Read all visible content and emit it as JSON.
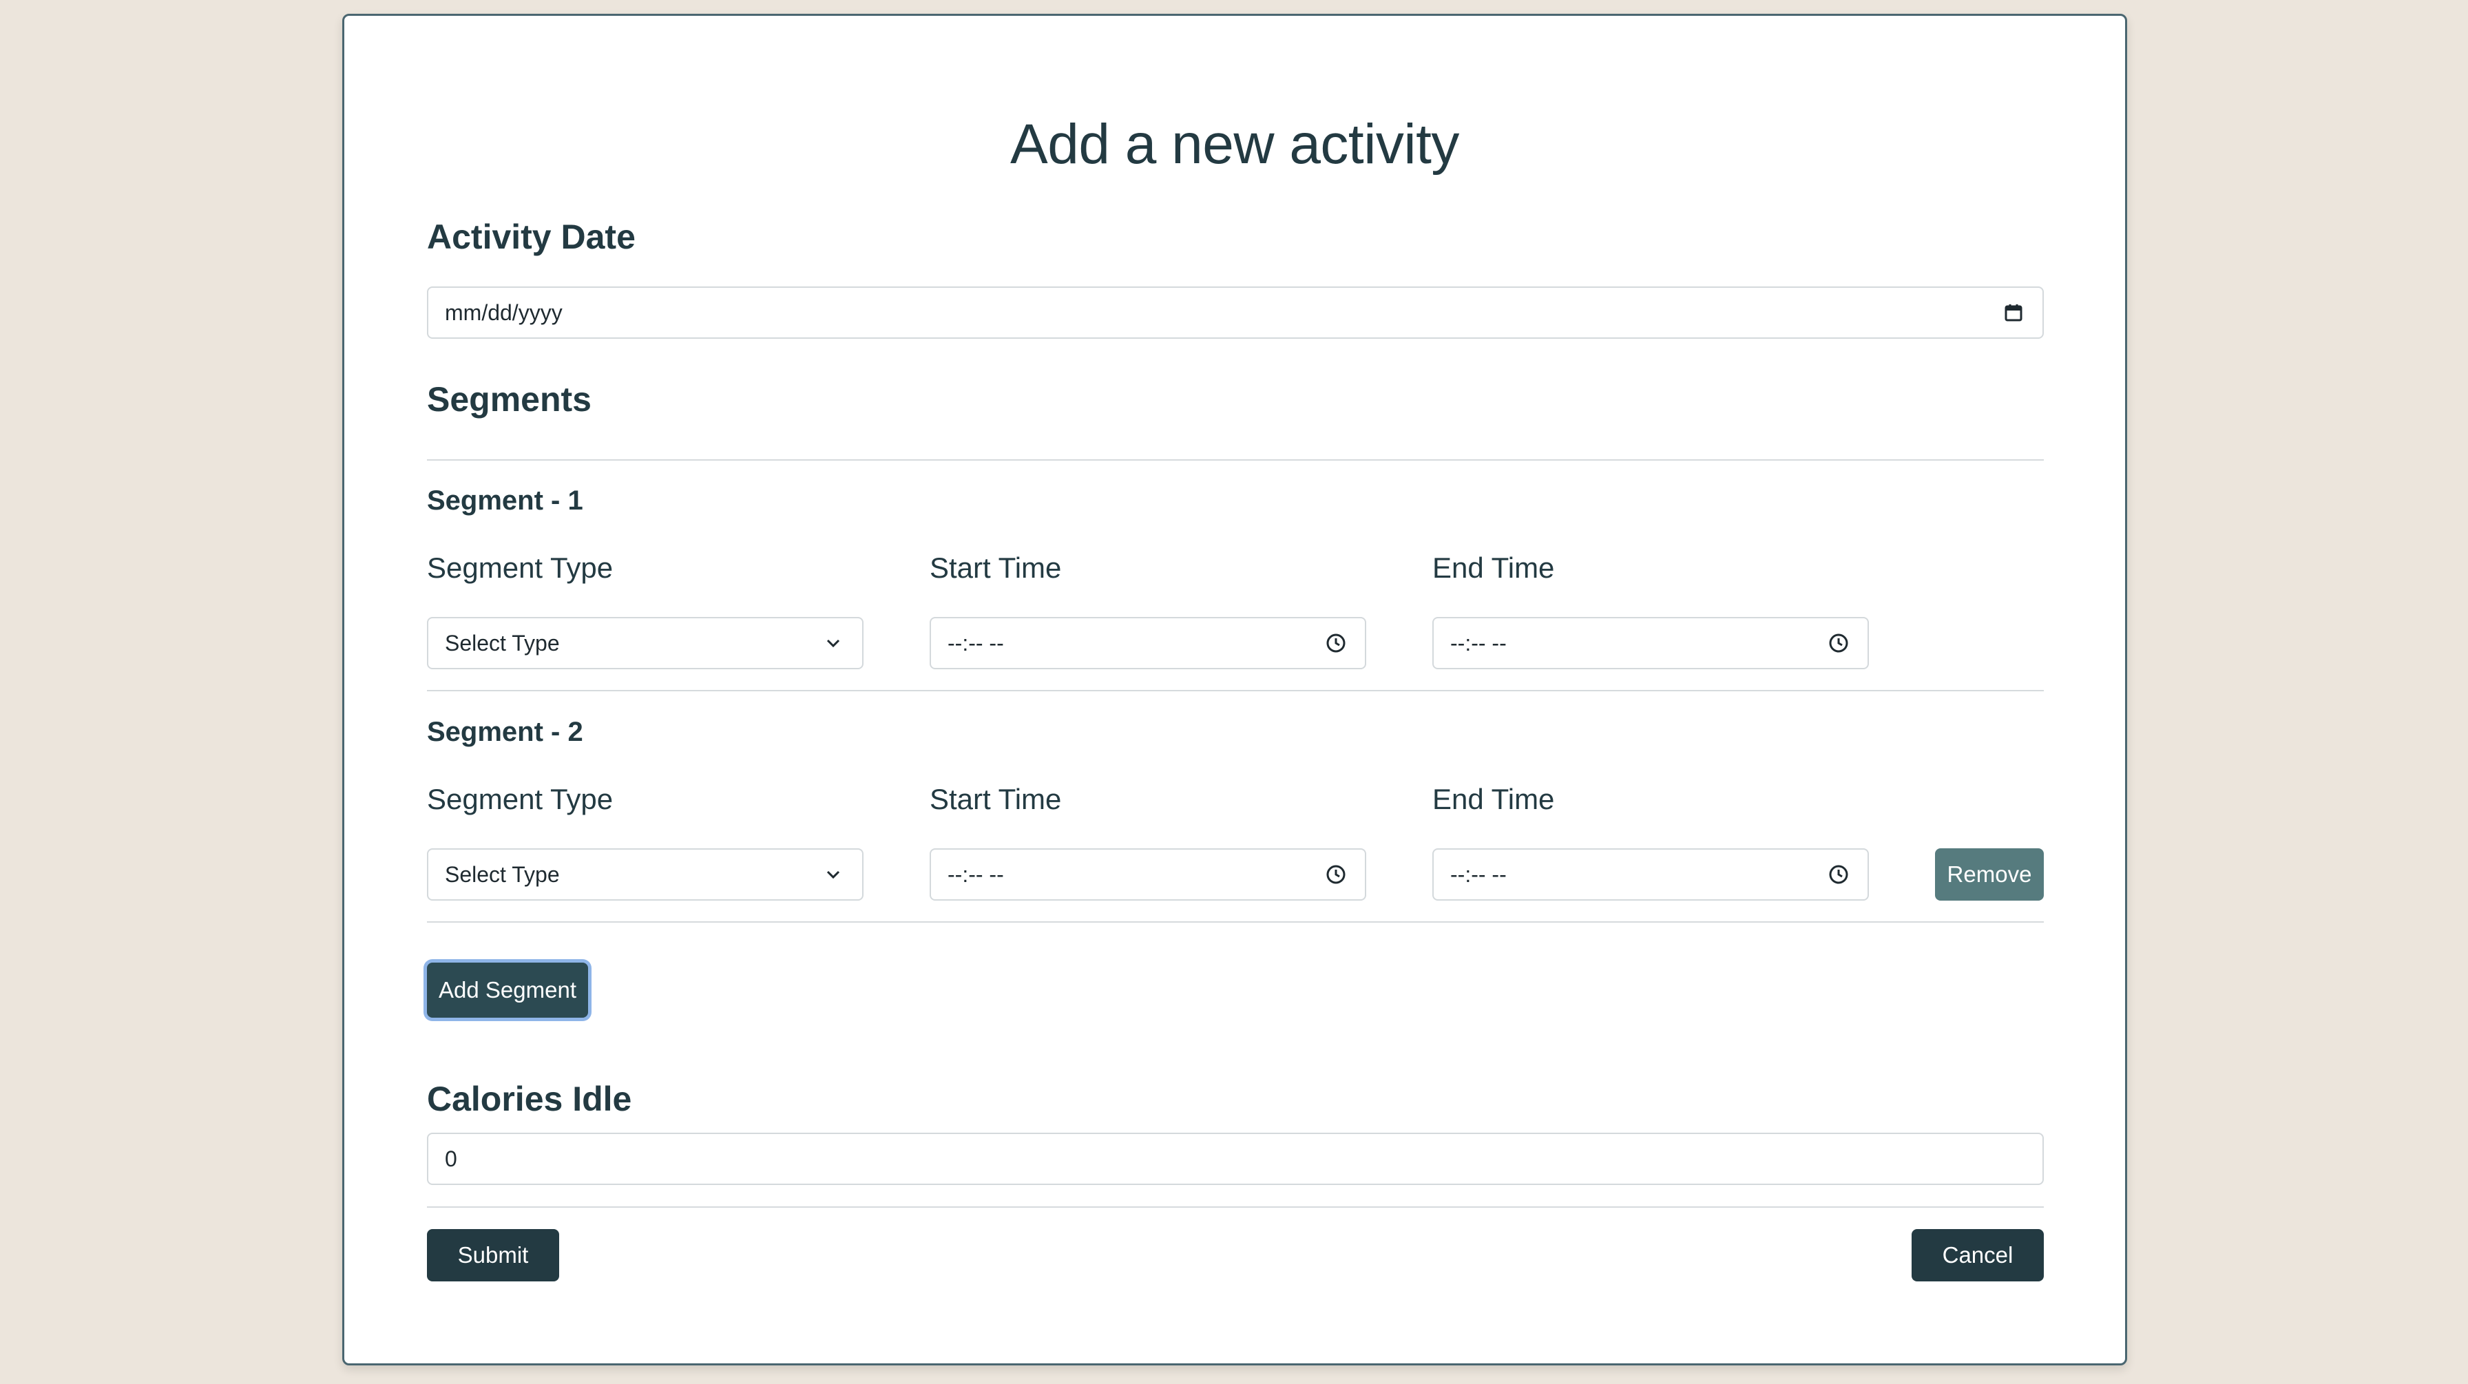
{
  "page": {
    "title": "Add a new activity"
  },
  "activity_date": {
    "heading": "Activity Date",
    "placeholder": "mm/dd/yyyy",
    "icon": "calendar-icon"
  },
  "segments": {
    "heading": "Segments",
    "items": [
      {
        "title": "Segment - 1",
        "type_label": "Segment Type",
        "type_value": "Select Type",
        "start_label": "Start Time",
        "start_value": "--:-- --",
        "end_label": "End Time",
        "end_value": "--:-- --"
      },
      {
        "title": "Segment - 2",
        "type_label": "Segment Type",
        "type_value": "Select Type",
        "start_label": "Start Time",
        "start_value": "--:-- --",
        "end_label": "End Time",
        "end_value": "--:-- --",
        "remove_label": "Remove"
      }
    ],
    "add_label": "Add Segment"
  },
  "calories": {
    "heading": "Calories Idle",
    "value": "0"
  },
  "actions": {
    "submit_label": "Submit",
    "cancel_label": "Cancel"
  },
  "colors": {
    "background": "#ece5dc",
    "text": "#233a42",
    "button_dark": "#233a42",
    "button_teal": "#567b7e",
    "focus_ring": "#8fb5e8"
  }
}
